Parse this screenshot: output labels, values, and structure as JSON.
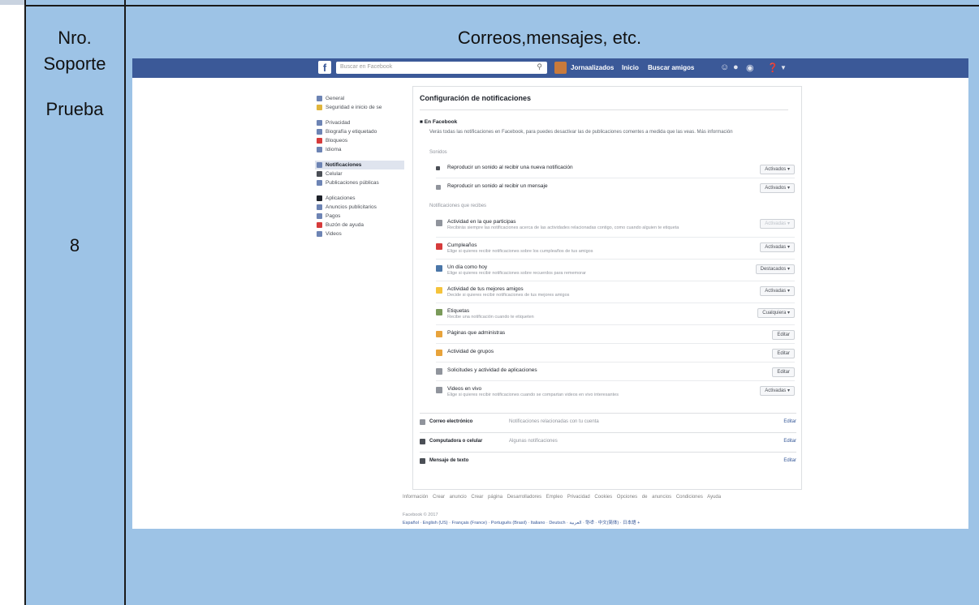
{
  "table": {
    "header_left_1": "Nro.",
    "header_left_2": "Soporte",
    "header_right": "Correos,mensajes, etc.",
    "row_label": "Prueba",
    "row_number": "8"
  },
  "colors": {
    "cell_fill": "#9dc3e6",
    "facebook_blue": "#3b5998"
  },
  "facebook": {
    "logo": "f",
    "search_placeholder": "Buscar en Facebook",
    "search_icon": "search-icon",
    "user_name": "Jornaalizados",
    "nav_home": "Inicio",
    "nav_find_friends": "Buscar amigos",
    "sidebar_groups": [
      [
        "General",
        "Seguridad e inicio de se"
      ],
      [
        "Privacidad",
        "Biografía y etiquetado",
        "Bloqueos",
        "Idioma"
      ],
      [
        "Notificaciones",
        "Celular",
        "Publicaciones públicas"
      ],
      [
        "Aplicaciones",
        "Anuncios publicitarios",
        "Pagos",
        "Buzón de ayuda",
        "Videos"
      ]
    ],
    "main_title": "Configuración de notificaciones",
    "section_title": "En Facebook",
    "section_desc": "Verás todas las notificaciones en Facebook, para puedes desactivar las de publicaciones comentes a medida que las veas. Más información",
    "label_sonidos": "Sonidos",
    "label_notificar": "Notificaciones que recibes",
    "rows_sounds": [
      {
        "label": "Reproducir un sonido al recibir una nueva notificación",
        "button": "Activados"
      },
      {
        "label": "Reproducir un sonido al recibir un mensaje",
        "button": "Activados"
      }
    ],
    "rows_notify": [
      {
        "label": "Actividad en la que participas",
        "desc": "Recibirás siempre las notificaciones acerca de las actividades relacionadas contigo, como cuando alguien te etiqueta",
        "button": "Activadas"
      },
      {
        "label": "Cumpleaños",
        "desc": "Elige si quieres recibir notificaciones sobre los cumpleaños de tus amigos",
        "button": "Activadas"
      },
      {
        "label": "Un día como hoy",
        "desc": "Elige si quieres recibir notificaciones sobre recuerdos para rememorar",
        "button": "Destacados"
      },
      {
        "label": "Actividad de tus mejores amigos",
        "desc": "Decide si quieres recibir notificaciones de tus mejores amigos",
        "button": "Activadas"
      },
      {
        "label": "Etiquetas",
        "desc": "Recibe una notificación cuando te etiqueten",
        "button": "Cualquiera"
      },
      {
        "label": "Páginas que administras",
        "desc": "",
        "button": "Editar"
      },
      {
        "label": "Actividad de grupos",
        "desc": "",
        "button": "Editar"
      },
      {
        "label": "Solicitudes y actividad de aplicaciones",
        "desc": "",
        "button": "Editar"
      },
      {
        "label": "Videos en vivo",
        "desc": "Elige si quieres recibir notificaciones cuando se compartan videos en vivo interesantes",
        "button": "Activadas"
      }
    ],
    "bottom_rows": [
      {
        "label": "Correo electrónico",
        "value": "Notificaciones relacionadas con tu cuenta",
        "edit": "Editar"
      },
      {
        "label": "Computadora o celular",
        "value": "Algunas notificaciones",
        "edit": "Editar"
      },
      {
        "label": "Mensaje de texto",
        "value": "",
        "edit": "Editar"
      }
    ],
    "footer_links": "Información  Crear anuncio  Crear página  Desarrolladores  Empleo  Privacidad  Cookies  Opciones de anuncios  Condiciones  Ayuda",
    "copyright": "Facebook © 2017",
    "languages": "Español · English (US) · Français (France) · Português (Brasil) · Italiano · Deutsch · العربية · हिन्दी · 中文(简体) · 日本語  +"
  }
}
